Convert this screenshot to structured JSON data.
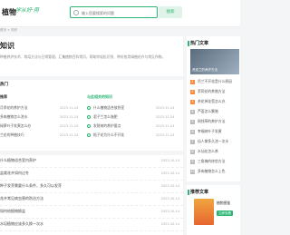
{
  "header": {
    "logo": "植物",
    "logo_tag": "学从好·用",
    "search_placeholder": "输入您要搜索的问题",
    "search_button": "搜索"
  },
  "breadcrumb": "首页 > 知识",
  "main": {
    "title": "知识",
    "desc": "种植养护技术、栽培方法与日常管理，汇集植物百科常识，帮助你轻松识别、种好各类绿植花卉与常见作物。"
  },
  "section": {
    "heading": "热门",
    "left_head": "推荐",
    "right_head": "与此相关的知识",
    "left_rows": [
      {
        "t": "月季花的养护方法",
        "d": "2023-11-24"
      },
      {
        "t": "多肉植物怎么浇水",
        "d": "2023-11-24"
      },
      {
        "t": "绿萝叶子发黄怎么办",
        "d": "2023-11-24"
      },
      {
        "t": "兰花的种植技巧",
        "d": "2023-11-24"
      }
    ],
    "right_rows": [
      {
        "t": "什么植物适合放卧室",
        "d": "2023-11-24"
      },
      {
        "t": "君子兰怎么施肥",
        "d": "2023-11-24"
      },
      {
        "t": "发财树的养护要点",
        "d": "2023-11-24"
      },
      {
        "t": "栀子花为什么不开花",
        "d": "2023-11-24"
      }
    ]
  },
  "list": [
    {
      "t": "什么植物适合室内养护",
      "d": "2023-10-14"
    },
    {
      "t": "盆栽花卉如何过冬",
      "d": "2023-10-14"
    },
    {
      "t": "种子发芽需要什么条件，多久可以发芽",
      "d": "2023-10-14"
    },
    {
      "t": "花卉常见病虫害的防治方法",
      "d": "2023-10-14"
    },
    {
      "t": "如何给植物换盆",
      "d": "2023-10-14"
    },
    {
      "t": "水培植物应该多久换一次水",
      "d": "2023-10-14"
    }
  ],
  "side": {
    "heading": "热门文章",
    "image_caption": "虎皮兰的养护方法",
    "items": [
      {
        "n": "1",
        "t": "吊兰不开花是什么原因"
      },
      {
        "n": "2",
        "t": "茉莉花的养殖方法"
      },
      {
        "n": "3",
        "t": "茶花掉花苞怎么办"
      },
      {
        "n": "4",
        "t": "芦荟怎么繁殖"
      },
      {
        "n": "5",
        "t": "铜钱草的养护方法"
      },
      {
        "n": "6",
        "t": "幸福树叶子发黄"
      },
      {
        "n": "7",
        "t": "仙人掌多久浇一次水"
      },
      {
        "n": "8",
        "t": "水仙花怎么养"
      },
      {
        "n": "9",
        "t": "三角梅的修剪方法"
      },
      {
        "n": "10",
        "t": "多肉植物怎么上色"
      }
    ]
  },
  "side2": {
    "heading": "推荐文章",
    "book_tag": "植物图鉴",
    "book_button": "立即查看",
    "items": [
      "常见绿植图鉴大全",
      "花卉养护入门手册",
      "阳台种菜指南"
    ]
  },
  "colors": {
    "accent": "#2bb673",
    "hot": "#ff8a3c"
  }
}
